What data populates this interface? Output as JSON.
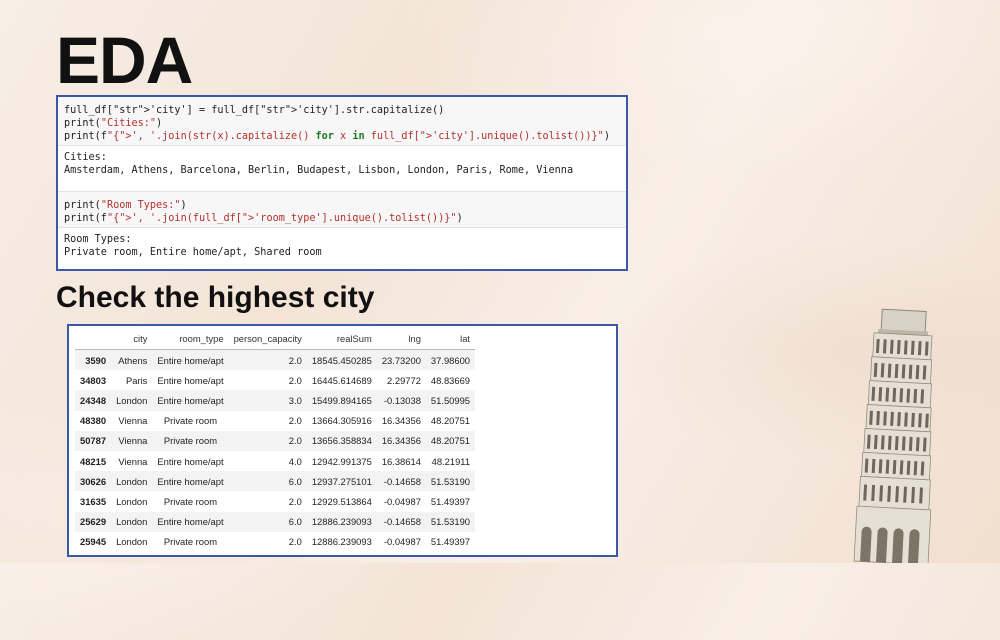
{
  "slide": {
    "title": "EDA",
    "subtitle": "Check the highest city"
  },
  "code": {
    "cell1_lines": [
      "full_df['city'] = full_df['city'].str.capitalize()",
      "print(\"Cities:\")",
      "print(f\"{', '.join(str(x).capitalize() for x in full_df['city'].unique().tolist())}\")"
    ],
    "cell1_output": [
      "Cities:",
      "Amsterdam, Athens, Barcelona, Berlin, Budapest, Lisbon, London, Paris, Rome, Vienna"
    ],
    "cell2_lines": [
      "print(\"Room Types:\")",
      "print(f\"{', '.join(full_df['room_type'].unique().tolist())}\")"
    ],
    "cell2_output": [
      "Room Types:",
      "Private room, Entire home/apt, Shared room"
    ]
  },
  "table": {
    "columns": [
      "",
      "city",
      "room_type",
      "person_capacity",
      "realSum",
      "lng",
      "lat"
    ],
    "rows": [
      [
        "3590",
        "Athens",
        "Entire home/apt",
        "2.0",
        "18545.450285",
        "23.73200",
        "37.98600"
      ],
      [
        "34803",
        "Paris",
        "Entire home/apt",
        "2.0",
        "16445.614689",
        "2.29772",
        "48.83669"
      ],
      [
        "24348",
        "London",
        "Entire home/apt",
        "3.0",
        "15499.894165",
        "-0.13038",
        "51.50995"
      ],
      [
        "48380",
        "Vienna",
        "Private room",
        "2.0",
        "13664.305916",
        "16.34356",
        "48.20751"
      ],
      [
        "50787",
        "Vienna",
        "Private room",
        "2.0",
        "13656.358834",
        "16.34356",
        "48.20751"
      ],
      [
        "48215",
        "Vienna",
        "Entire home/apt",
        "4.0",
        "12942.991375",
        "16.38614",
        "48.21911"
      ],
      [
        "30626",
        "London",
        "Entire home/apt",
        "6.0",
        "12937.275101",
        "-0.14658",
        "51.53190"
      ],
      [
        "31635",
        "London",
        "Private room",
        "2.0",
        "12929.513864",
        "-0.04987",
        "51.49397"
      ],
      [
        "25629",
        "London",
        "Entire home/apt",
        "6.0",
        "12886.239093",
        "-0.14658",
        "51.53190"
      ],
      [
        "25945",
        "London",
        "Private room",
        "2.0",
        "12886.239093",
        "-0.04987",
        "51.49397"
      ]
    ]
  },
  "decor": {
    "tower_icon": "leaning-tower-of-pisa-illustration"
  }
}
